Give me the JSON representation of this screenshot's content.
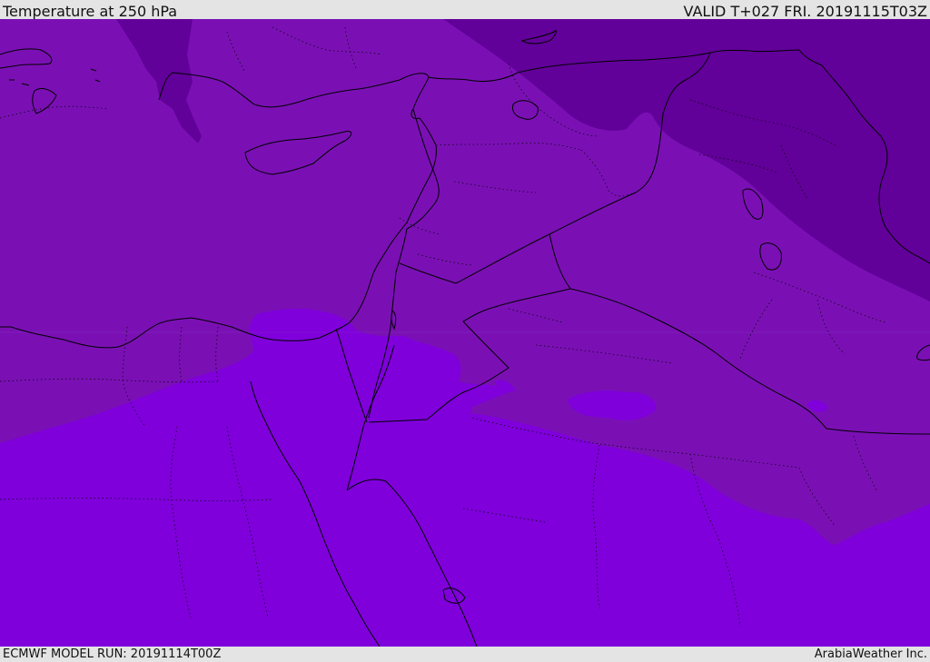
{
  "header": {
    "title": "Temperature at 250 hPa",
    "valid_time": "VALID T+027 FRI. 20191115T03Z"
  },
  "footer": {
    "model_run": "ECMWF MODEL RUN: 20191114T00Z",
    "credit": "ArabiaWeather Inc."
  },
  "colors": {
    "bar_background": "#e4e4e4",
    "temp_band_coldest": "#62009a",
    "temp_band_mid": "#7a10b4",
    "temp_band_warmest": "#7f00db",
    "border_lines": "#000000"
  }
}
